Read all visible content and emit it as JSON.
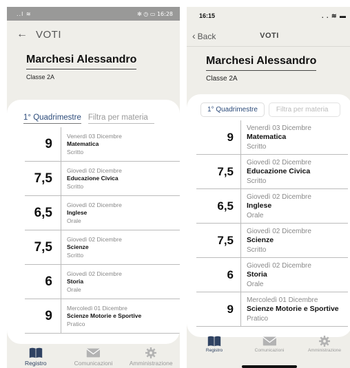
{
  "android": {
    "status": {
      "signal": "..l ≋",
      "icons": "✻ ◷ ▭",
      "time": "16:28"
    },
    "nav": {
      "back": "←",
      "title": "VOTI"
    }
  },
  "ios": {
    "status": {
      "time": "16:15",
      "icons": ". . ≋ ▬"
    },
    "nav": {
      "back": "Back",
      "title": "VOTI"
    }
  },
  "student": {
    "name": "Marchesi Alessandro",
    "class": "Classe 2A"
  },
  "filters": {
    "period": "1° Quadrimestre",
    "subject_placeholder": "Filtra per materia"
  },
  "android_grades": [
    {
      "grade": "9",
      "date": "Venerdì 03 Dicembre",
      "subject": "Matematica",
      "type": "Scritto"
    },
    {
      "grade": "7,5",
      "date": "Giovedì 02 Dicembre",
      "subject": "Educazione Civica",
      "type": "Scritto"
    },
    {
      "grade": "6,5",
      "date": "Giovedì 02 Dicembre",
      "subject": "Inglese",
      "type": "Orale"
    },
    {
      "grade": "7,5",
      "date": "Giovedì 02 Dicembre",
      "subject": "Scienze",
      "type": "Scritto"
    },
    {
      "grade": "6",
      "date": "Giovedì 02 Dicembre",
      "subject": "Storia",
      "type": "Orale"
    },
    {
      "grade": "9",
      "date": "Mercoledì 01 Dicembre",
      "subject": "Scienze Motorie e Sportive",
      "type": "Pratico"
    }
  ],
  "ios_grades": [
    {
      "grade": "9",
      "date": "Venerdì 03 Dicembre",
      "subject": "Matematica",
      "type": "Scritto"
    },
    {
      "grade": "7,5",
      "date": "Giovedì 02 Dicembre",
      "subject": "Educazione Civica",
      "type": "Scritto"
    },
    {
      "grade": "6,5",
      "date": "Giovedì 02 Dicembre",
      "subject": "Inglese",
      "type": "Orale"
    },
    {
      "grade": "7,5",
      "date": "Giovedì 02 Dicembre",
      "subject": "Scienze",
      "type": "Scritto"
    },
    {
      "grade": "6",
      "date": "Giovedì 02 Dicembre",
      "subject": "Storia",
      "type": "Orale"
    },
    {
      "grade": "9",
      "date": "Mercoledì 01 Dicembre",
      "subject": "Scienze Motorie e Sportive",
      "type": "Pratico"
    }
  ],
  "tabbar": [
    {
      "label": "Registro",
      "icon": "book-icon",
      "active": true
    },
    {
      "label": "Comunicazioni",
      "icon": "envelope-icon",
      "active": false
    },
    {
      "label": "Amministrazione",
      "icon": "gear-icon",
      "active": false
    }
  ],
  "colors": {
    "active": "#2f4262",
    "inactive": "#b3b3b3",
    "link": "#2c4b7a",
    "background": "#efeee9"
  }
}
